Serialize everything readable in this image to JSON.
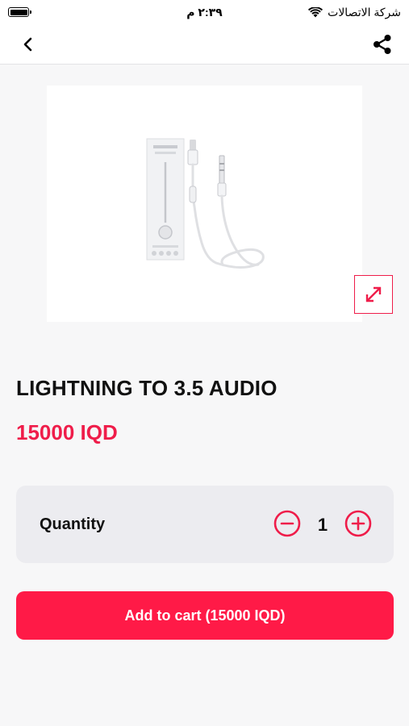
{
  "status_bar": {
    "carrier": "شركة الاتصالات",
    "time": "٢:٣٩ م"
  },
  "nav": {
    "back_icon": "chevron-left-icon",
    "share_icon": "share-icon"
  },
  "product": {
    "title": "LIGHTNING TO 3.5 AUDIO",
    "price": "15000 IQD",
    "expand_icon": "expand-icon"
  },
  "quantity": {
    "label": "Quantity",
    "value": "1",
    "decrement_icon": "minus-circle-icon",
    "increment_icon": "plus-circle-icon"
  },
  "cart": {
    "button_label": "Add to cart (15000 IQD)"
  },
  "colors": {
    "accent": "#ff1a47",
    "price": "#ef1d4a",
    "card_bg": "#ececf0",
    "page_bg": "#f7f7f8"
  }
}
